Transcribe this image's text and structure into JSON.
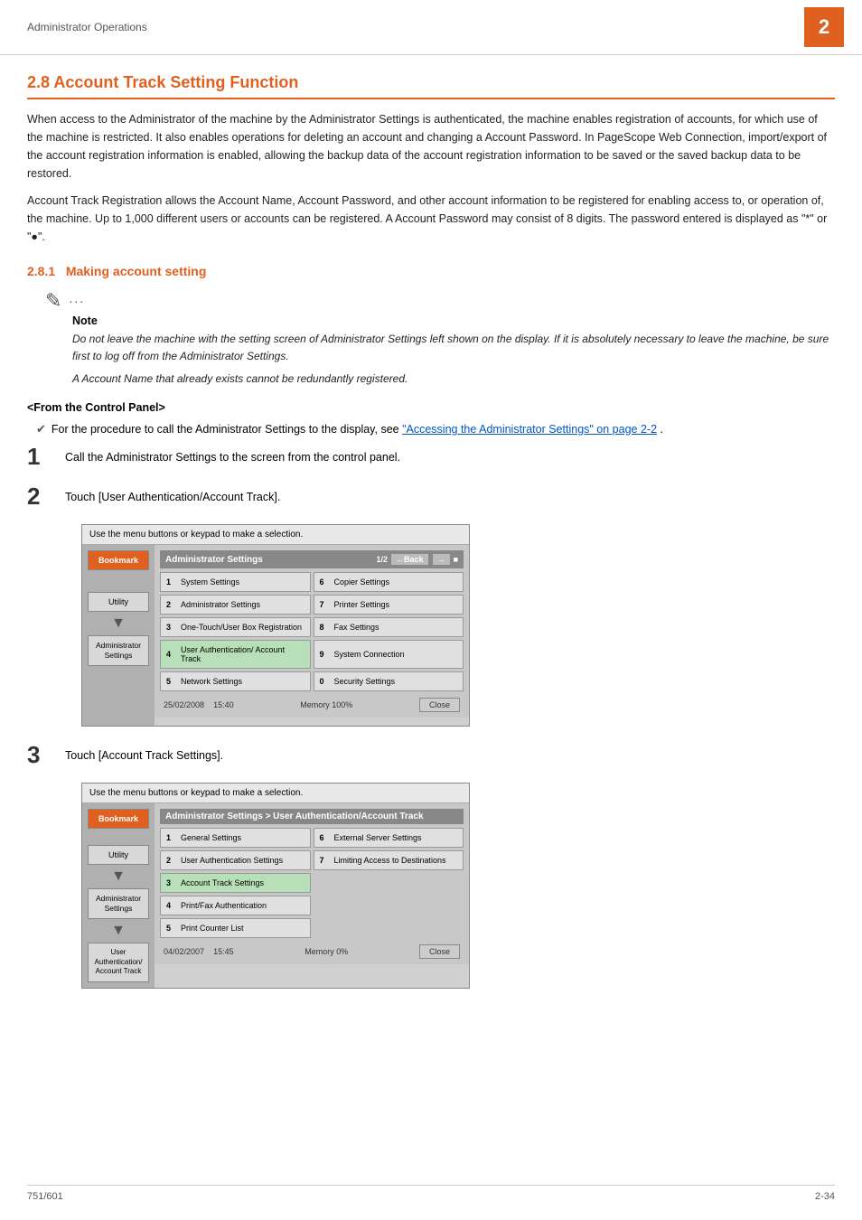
{
  "header": {
    "title": "Administrator Operations",
    "page_number": "2"
  },
  "section": {
    "number": "2.8",
    "title": "Account Track Setting Function",
    "intro_para1": "When access to the Administrator of the machine by the Administrator Settings is authenticated, the machine enables registration of accounts, for which use of the machine is restricted. It also enables operations for deleting an account and changing a Account Password. In PageScope Web Connection, import/export of the account registration information is enabled, allowing the backup data of the account registration information to be saved or the saved backup data to be restored.",
    "intro_para2": "Account Track Registration allows the Account Name, Account Password, and other account information to be registered for enabling access to, or operation of, the machine. Up to 1,000 different users or accounts can be registered. A Account Password may consist of 8 digits. The password entered is displayed as \"*\" or \"●\"."
  },
  "subsection": {
    "number": "2.8.1",
    "title": "Making account setting"
  },
  "note": {
    "symbol": "✎",
    "dots": "...",
    "label": "Note",
    "text1": "Do not leave the machine with the setting screen of Administrator Settings left shown on the display. If it is absolutely necessary to leave the machine, be sure first to log off from the Administrator Settings.",
    "text2": "A Account Name that already exists cannot be redundantly registered."
  },
  "control_panel": {
    "label": "<From the Control Panel>",
    "bullet_text_pre": "For the procedure to call the Administrator Settings to the display, see ",
    "bullet_link": "\"Accessing the Administrator Settings\" on page 2-2",
    "bullet_text_post": "."
  },
  "steps": [
    {
      "number": "1",
      "text": "Call the Administrator Settings to the screen from the control panel."
    },
    {
      "number": "2",
      "text": "Touch [User Authentication/Account Track]."
    },
    {
      "number": "3",
      "text": "Touch [Account Track Settings]."
    }
  ],
  "screen1": {
    "instruction": "Use the menu buttons or keypad to make a selection.",
    "title": "Administrator Settings",
    "nav_page": "1/2",
    "nav_back": "←Back",
    "nav_forward": "→",
    "buttons_left": [
      {
        "num": "1",
        "label": "System Settings"
      },
      {
        "num": "2",
        "label": "Administrator Settings"
      },
      {
        "num": "3",
        "label": "One-Touch/User Box Registration"
      },
      {
        "num": "4",
        "label": "User Authentication/ Account Track"
      },
      {
        "num": "5",
        "label": "Network Settings"
      }
    ],
    "buttons_right": [
      {
        "num": "6",
        "label": "Copier Settings"
      },
      {
        "num": "7",
        "label": "Printer Settings"
      },
      {
        "num": "8",
        "label": "Fax Settings"
      },
      {
        "num": "9",
        "label": "System Connection"
      },
      {
        "num": "0",
        "label": "Security Settings"
      }
    ],
    "footer_date": "25/02/2008",
    "footer_time": "15:40",
    "footer_memory": "Memory",
    "footer_memory_val": "100%",
    "close_label": "Close",
    "sidebar": {
      "bookmark": "Bookmark",
      "utility": "Utility",
      "admin": "Administrator Settings"
    }
  },
  "screen2": {
    "instruction": "Use the menu buttons or keypad to make a selection.",
    "title": "Administrator Settings > User Authentication/Account Track",
    "buttons_left": [
      {
        "num": "1",
        "label": "General Settings"
      },
      {
        "num": "2",
        "label": "User Authentication Settings"
      },
      {
        "num": "3",
        "label": "Account Track Settings"
      },
      {
        "num": "4",
        "label": "Print/Fax Authentication"
      },
      {
        "num": "5",
        "label": "Print Counter List"
      }
    ],
    "buttons_right": [
      {
        "num": "6",
        "label": "External Server Settings"
      },
      {
        "num": "7",
        "label": "Limiting Access to Destinations"
      }
    ],
    "footer_date": "04/02/2007",
    "footer_time": "15:45",
    "footer_memory": "Memory",
    "footer_memory_val": "0%",
    "close_label": "Close",
    "sidebar": {
      "bookmark": "Bookmark",
      "utility": "Utility",
      "admin": "Administrator Settings",
      "user_auth": "User Authentication/ Account Track"
    }
  },
  "footer": {
    "left": "751/601",
    "right": "2-34"
  }
}
